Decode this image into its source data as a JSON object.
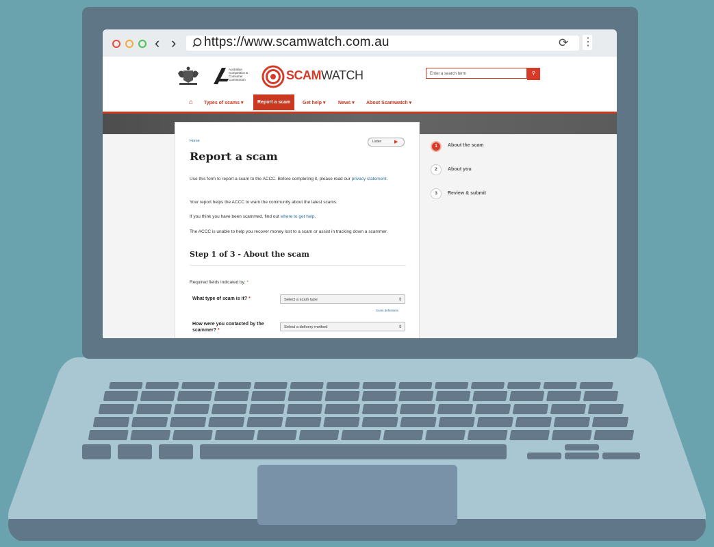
{
  "browser": {
    "url": "https://www.scamwatch.com.au"
  },
  "site": {
    "accc_text": "Australian Competition & Consumer Commission",
    "logo_word_bold": "SCAM",
    "logo_word_rest": "WATCH",
    "search_placeholder": "Enter a search term",
    "nav": [
      "Types of scams ▾",
      "Report a scam",
      "Get help ▾",
      "News ▾",
      "About Scamwatch ▾"
    ]
  },
  "page": {
    "breadcrumb": "Home",
    "listen_label": "Listen",
    "title": "Report a scam",
    "intro_1_pre": "Use this form to report a scam to the ACCC. Before completing it, please read our ",
    "intro_1_link": "privacy statement",
    "intro_1_post": ".",
    "intro_2": "Your report helps the ACCC to warn the community about the latest scams.",
    "intro_3_pre": "If you think you have been scammed, find out ",
    "intro_3_link": "where to get help",
    "intro_3_post": ".",
    "intro_4": "The ACCC is unable to help you recover money lost to a scam or assist in tracking down a scammer.",
    "step_heading": "Step 1 of 3 - About the scam",
    "required_note": "Required fields indicated by: ",
    "required_star": "*",
    "q1_label": "What type of scam is it? ",
    "q1_select": "Select a scam type",
    "scam_definitions": "Scam definitions",
    "q2_label": "How were you contacted by the scammer? ",
    "q2_select": "Select a delivery method"
  },
  "steps": [
    {
      "num": "1",
      "label": "About the scam"
    },
    {
      "num": "2",
      "label": "About you"
    },
    {
      "num": "3",
      "label": "Review & submit"
    }
  ],
  "colors": {
    "background": "#6aa3ad",
    "laptop_lid": "#5e7686",
    "brand_red": "#d63a28"
  }
}
